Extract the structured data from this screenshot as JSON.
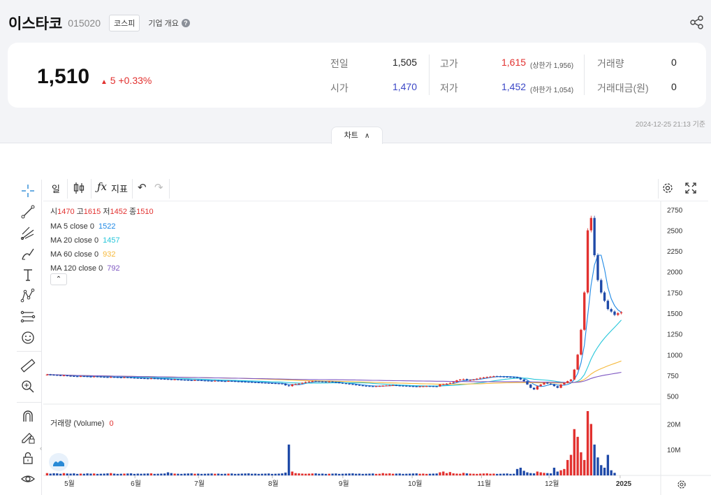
{
  "header": {
    "name": "이스타코",
    "code": "015020",
    "market": "코스피",
    "overview_label": "기업 개요",
    "price": "1,510",
    "change": "5 +0.33%",
    "timestamp": "2024-12-25 21:13 기준",
    "chart_tab": "차트"
  },
  "quote": {
    "prev_label": "전일",
    "prev": "1,505",
    "open_label": "시가",
    "open": "1,470",
    "high_label": "고가",
    "high": "1,615",
    "upper_limit": "(상한가 1,956)",
    "low_label": "저가",
    "low": "1,452",
    "lower_limit": "(하한가 1,054)",
    "vol_label": "거래량",
    "vol": "0",
    "amount_label": "거래대금(원)",
    "amount": "0"
  },
  "toolbar": {
    "period": "일",
    "indicator": "지표"
  },
  "ohlc": {
    "o_label": "시",
    "o": "1470",
    "h_label": "고",
    "h": "1615",
    "l_label": "저",
    "l": "1452",
    "c_label": "종",
    "c": "1510"
  },
  "ma": [
    {
      "label": "MA 5 close 0",
      "value": "1522",
      "color": "#1e88e5"
    },
    {
      "label": "MA 20 close 0",
      "value": "1457",
      "color": "#26c6da"
    },
    {
      "label": "MA 60 close 0",
      "value": "932",
      "color": "#f6b93b"
    },
    {
      "label": "MA 120 close 0",
      "value": "792",
      "color": "#7e57c2"
    }
  ],
  "volume": {
    "label": "거래량 (Volume)",
    "value": "0"
  },
  "colors": {
    "up": "#e2312f",
    "down": "#1f4aa8"
  },
  "chart_data": {
    "type": "candlestick",
    "title": "",
    "y_ticks": [
      "2750",
      "2500",
      "2250",
      "2000",
      "1750",
      "1500",
      "1250",
      "1000",
      "750",
      "500"
    ],
    "volume_ticks": [
      "20M",
      "10M"
    ],
    "x_labels": [
      "5월",
      "6월",
      "7월",
      "8월",
      "9월",
      "10월",
      "11월",
      "12월",
      "2025"
    ],
    "ylim": [
      420,
      2850
    ],
    "volume_max": 25000000,
    "series_start_x": 0,
    "close": [
      760,
      758,
      755,
      752,
      748,
      750,
      745,
      742,
      740,
      738,
      741,
      739,
      736,
      734,
      737,
      735,
      732,
      730,
      728,
      731,
      729,
      726,
      724,
      727,
      725,
      722,
      720,
      718,
      716,
      714,
      712,
      715,
      713,
      710,
      708,
      706,
      704,
      700,
      702,
      699,
      697,
      695,
      693,
      690,
      694,
      692,
      689,
      687,
      685,
      683,
      686,
      684,
      681,
      679,
      683,
      681,
      678,
      676,
      674,
      672,
      670,
      668,
      666,
      664,
      662,
      660,
      658,
      656,
      654,
      652,
      650,
      630,
      620,
      640,
      645,
      650,
      660,
      670,
      675,
      680,
      678,
      676,
      674,
      672,
      675,
      670,
      665,
      660,
      655,
      650,
      645,
      640,
      635,
      630,
      625,
      622,
      620,
      618,
      620,
      622,
      625,
      628,
      630,
      632,
      628,
      626,
      624,
      622,
      620,
      618,
      616,
      617,
      619,
      621,
      620,
      618,
      616,
      640,
      645,
      650,
      660,
      670,
      690,
      700,
      705,
      690,
      695,
      700,
      710,
      720,
      725,
      730,
      735,
      740,
      738,
      736,
      734,
      732,
      730,
      728,
      720,
      700,
      680,
      640,
      600,
      580,
      620,
      640,
      660,
      650,
      640,
      620,
      600,
      640,
      660,
      680,
      700,
      820,
      1000,
      1300,
      1750,
      2500,
      2650,
      2200,
      1900,
      1750,
      1650,
      1550,
      1520,
      1480,
      1500,
      1510
    ],
    "volume_values": [
      900000,
      700000,
      850000,
      800000,
      650000,
      900000,
      750000,
      700000,
      800000,
      600000,
      700000,
      650000,
      800000,
      700000,
      750000,
      600000,
      650000,
      700000,
      800000,
      900000,
      700000,
      600000,
      650000,
      700000,
      750000,
      800000,
      600000,
      700000,
      650000,
      700000,
      750000,
      800000,
      600000,
      650000,
      700000,
      750000,
      1200000,
      900000,
      700000,
      650000,
      600000,
      700000,
      750000,
      800000,
      650000,
      700000,
      600000,
      650000,
      700000,
      750000,
      650000,
      700000,
      600000,
      650000,
      700000,
      750000,
      600000,
      650000,
      700000,
      750000,
      800000,
      650000,
      700000,
      600000,
      650000,
      700000,
      750000,
      600000,
      650000,
      700000,
      800000,
      1100000,
      12000000,
      1500000,
      900000,
      800000,
      700000,
      650000,
      700000,
      750000,
      800000,
      650000,
      700000,
      600000,
      650000,
      700000,
      750000,
      600000,
      650000,
      700000,
      750000,
      800000,
      650000,
      700000,
      600000,
      650000,
      700000,
      750000,
      600000,
      650000,
      900000,
      700000,
      800000,
      650000,
      700000,
      750000,
      600000,
      650000,
      700000,
      750000,
      800000,
      650000,
      700000,
      600000,
      650000,
      700000,
      750000,
      1200000,
      1500000,
      900000,
      1300000,
      800000,
      700000,
      650000,
      1000000,
      800000,
      700000,
      650000,
      600000,
      700000,
      750000,
      800000,
      650000,
      700000,
      600000,
      650000,
      700000,
      750000,
      600000,
      650000,
      2500000,
      3000000,
      1800000,
      1200000,
      900000,
      800000,
      1500000,
      1200000,
      1000000,
      900000,
      800000,
      3000000,
      1500000,
      2000000,
      2500000,
      6000000,
      8000000,
      18000000,
      15000000,
      9000000,
      6000000,
      25000000,
      20000000,
      12000000,
      7000000,
      4000000,
      3000000,
      8000000,
      2000000,
      1000000
    ]
  }
}
